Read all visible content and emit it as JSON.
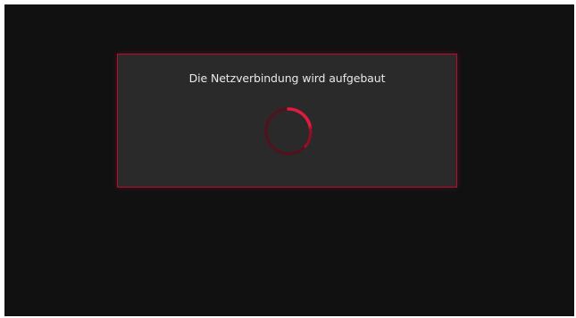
{
  "dialog": {
    "message": "Die Netzverbindung wird aufgebaut",
    "state": "connecting"
  },
  "spinner": {
    "icon": "loading-spinner-icon"
  },
  "colors": {
    "background": "#111111",
    "dialog_background": "#2a2a2a",
    "accent": "#b0102e",
    "text": "#e9e9e9"
  }
}
